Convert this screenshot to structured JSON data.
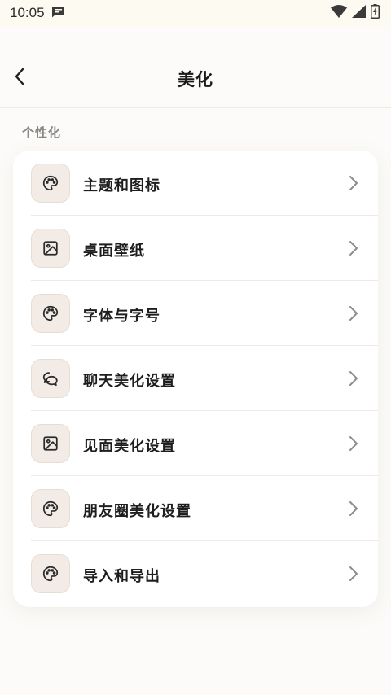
{
  "status_bar": {
    "time": "10:05",
    "icons": [
      "message-notification-icon",
      "wifi-icon",
      "cellular-signal-icon",
      "battery-charging-icon"
    ]
  },
  "nav": {
    "title": "美化",
    "back_icon": "chevron-left-icon"
  },
  "section": {
    "label": "个性化"
  },
  "menu": {
    "items": [
      {
        "label": "主题和图标",
        "icon": "palette-icon"
      },
      {
        "label": "桌面壁纸",
        "icon": "image-icon"
      },
      {
        "label": "字体与字号",
        "icon": "palette-icon"
      },
      {
        "label": "聊天美化设置",
        "icon": "chat-bubbles-icon"
      },
      {
        "label": "见面美化设置",
        "icon": "image-icon"
      },
      {
        "label": "朋友圈美化设置",
        "icon": "palette-icon"
      },
      {
        "label": "导入和导出",
        "icon": "palette-icon"
      }
    ]
  },
  "colors": {
    "background": "#fcfbf9",
    "card": "#ffffff",
    "icon_tile": "#f3ece6",
    "text_primary": "#1e1e1e",
    "text_secondary": "#8a8784"
  }
}
